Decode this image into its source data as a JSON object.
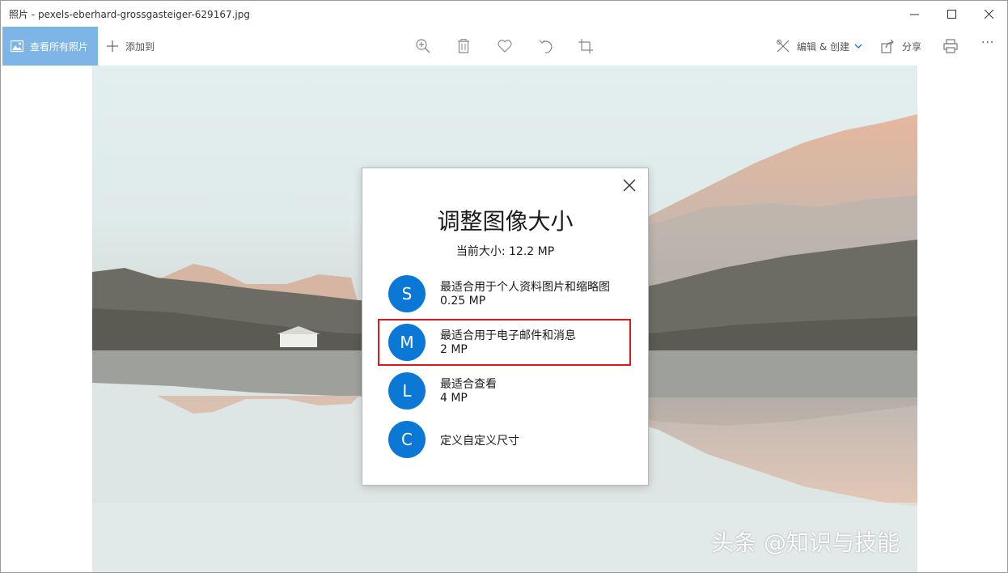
{
  "window": {
    "title": "照片 - pexels-eberhard-grossgasteiger-629167.jpg"
  },
  "toolbar": {
    "see_all_label": "查看所有照片",
    "add_to_label": "添加到",
    "edit_create_label": "编辑 & 创建",
    "share_label": "分享",
    "more_label": "···"
  },
  "photo": {
    "watermark": "头条 @知识与技能"
  },
  "dialog": {
    "title": "调整图像大小",
    "current_size": "当前大小: 12.2 MP",
    "options": [
      {
        "letter": "S",
        "label": "最适合用于个人资料图片和缩略图",
        "size": "0.25 MP"
      },
      {
        "letter": "M",
        "label": "最适合用于电子邮件和消息",
        "size": "2 MP"
      },
      {
        "letter": "L",
        "label": "最适合查看",
        "size": "4 MP"
      },
      {
        "letter": "C",
        "label": "定义自定义尺寸",
        "size": ""
      }
    ]
  },
  "colors": {
    "accent": "#0a78d4",
    "selected_tab": "#7db6e6",
    "highlight_border": "#e0161d"
  }
}
